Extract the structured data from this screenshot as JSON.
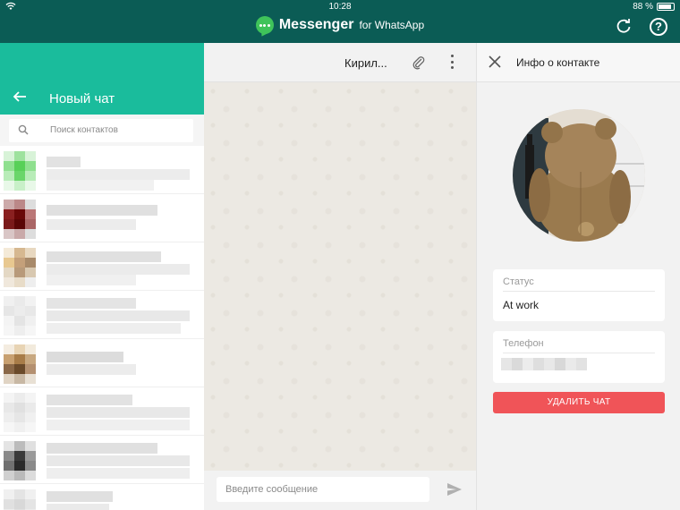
{
  "status_bar": {
    "time": "10:28",
    "battery": "88 %"
  },
  "app": {
    "name": "Messenger",
    "sub": "for WhatsApp"
  },
  "left_panel": {
    "title": "Новый чат",
    "search": {
      "placeholder": "Поиск контактов"
    }
  },
  "chat": {
    "contact_name": "Кирил...",
    "input": {
      "placeholder": "Введите сообщение"
    }
  },
  "contact_info": {
    "title": "Инфо о контакте",
    "status_label": "Статус",
    "status_value": "At work",
    "phone_label": "Телефон",
    "delete_label": "УДАЛИТЬ ЧАТ"
  },
  "colors": {
    "topbar": "#0b5c55",
    "accent": "#1abc9c",
    "delete": "#f05458"
  }
}
